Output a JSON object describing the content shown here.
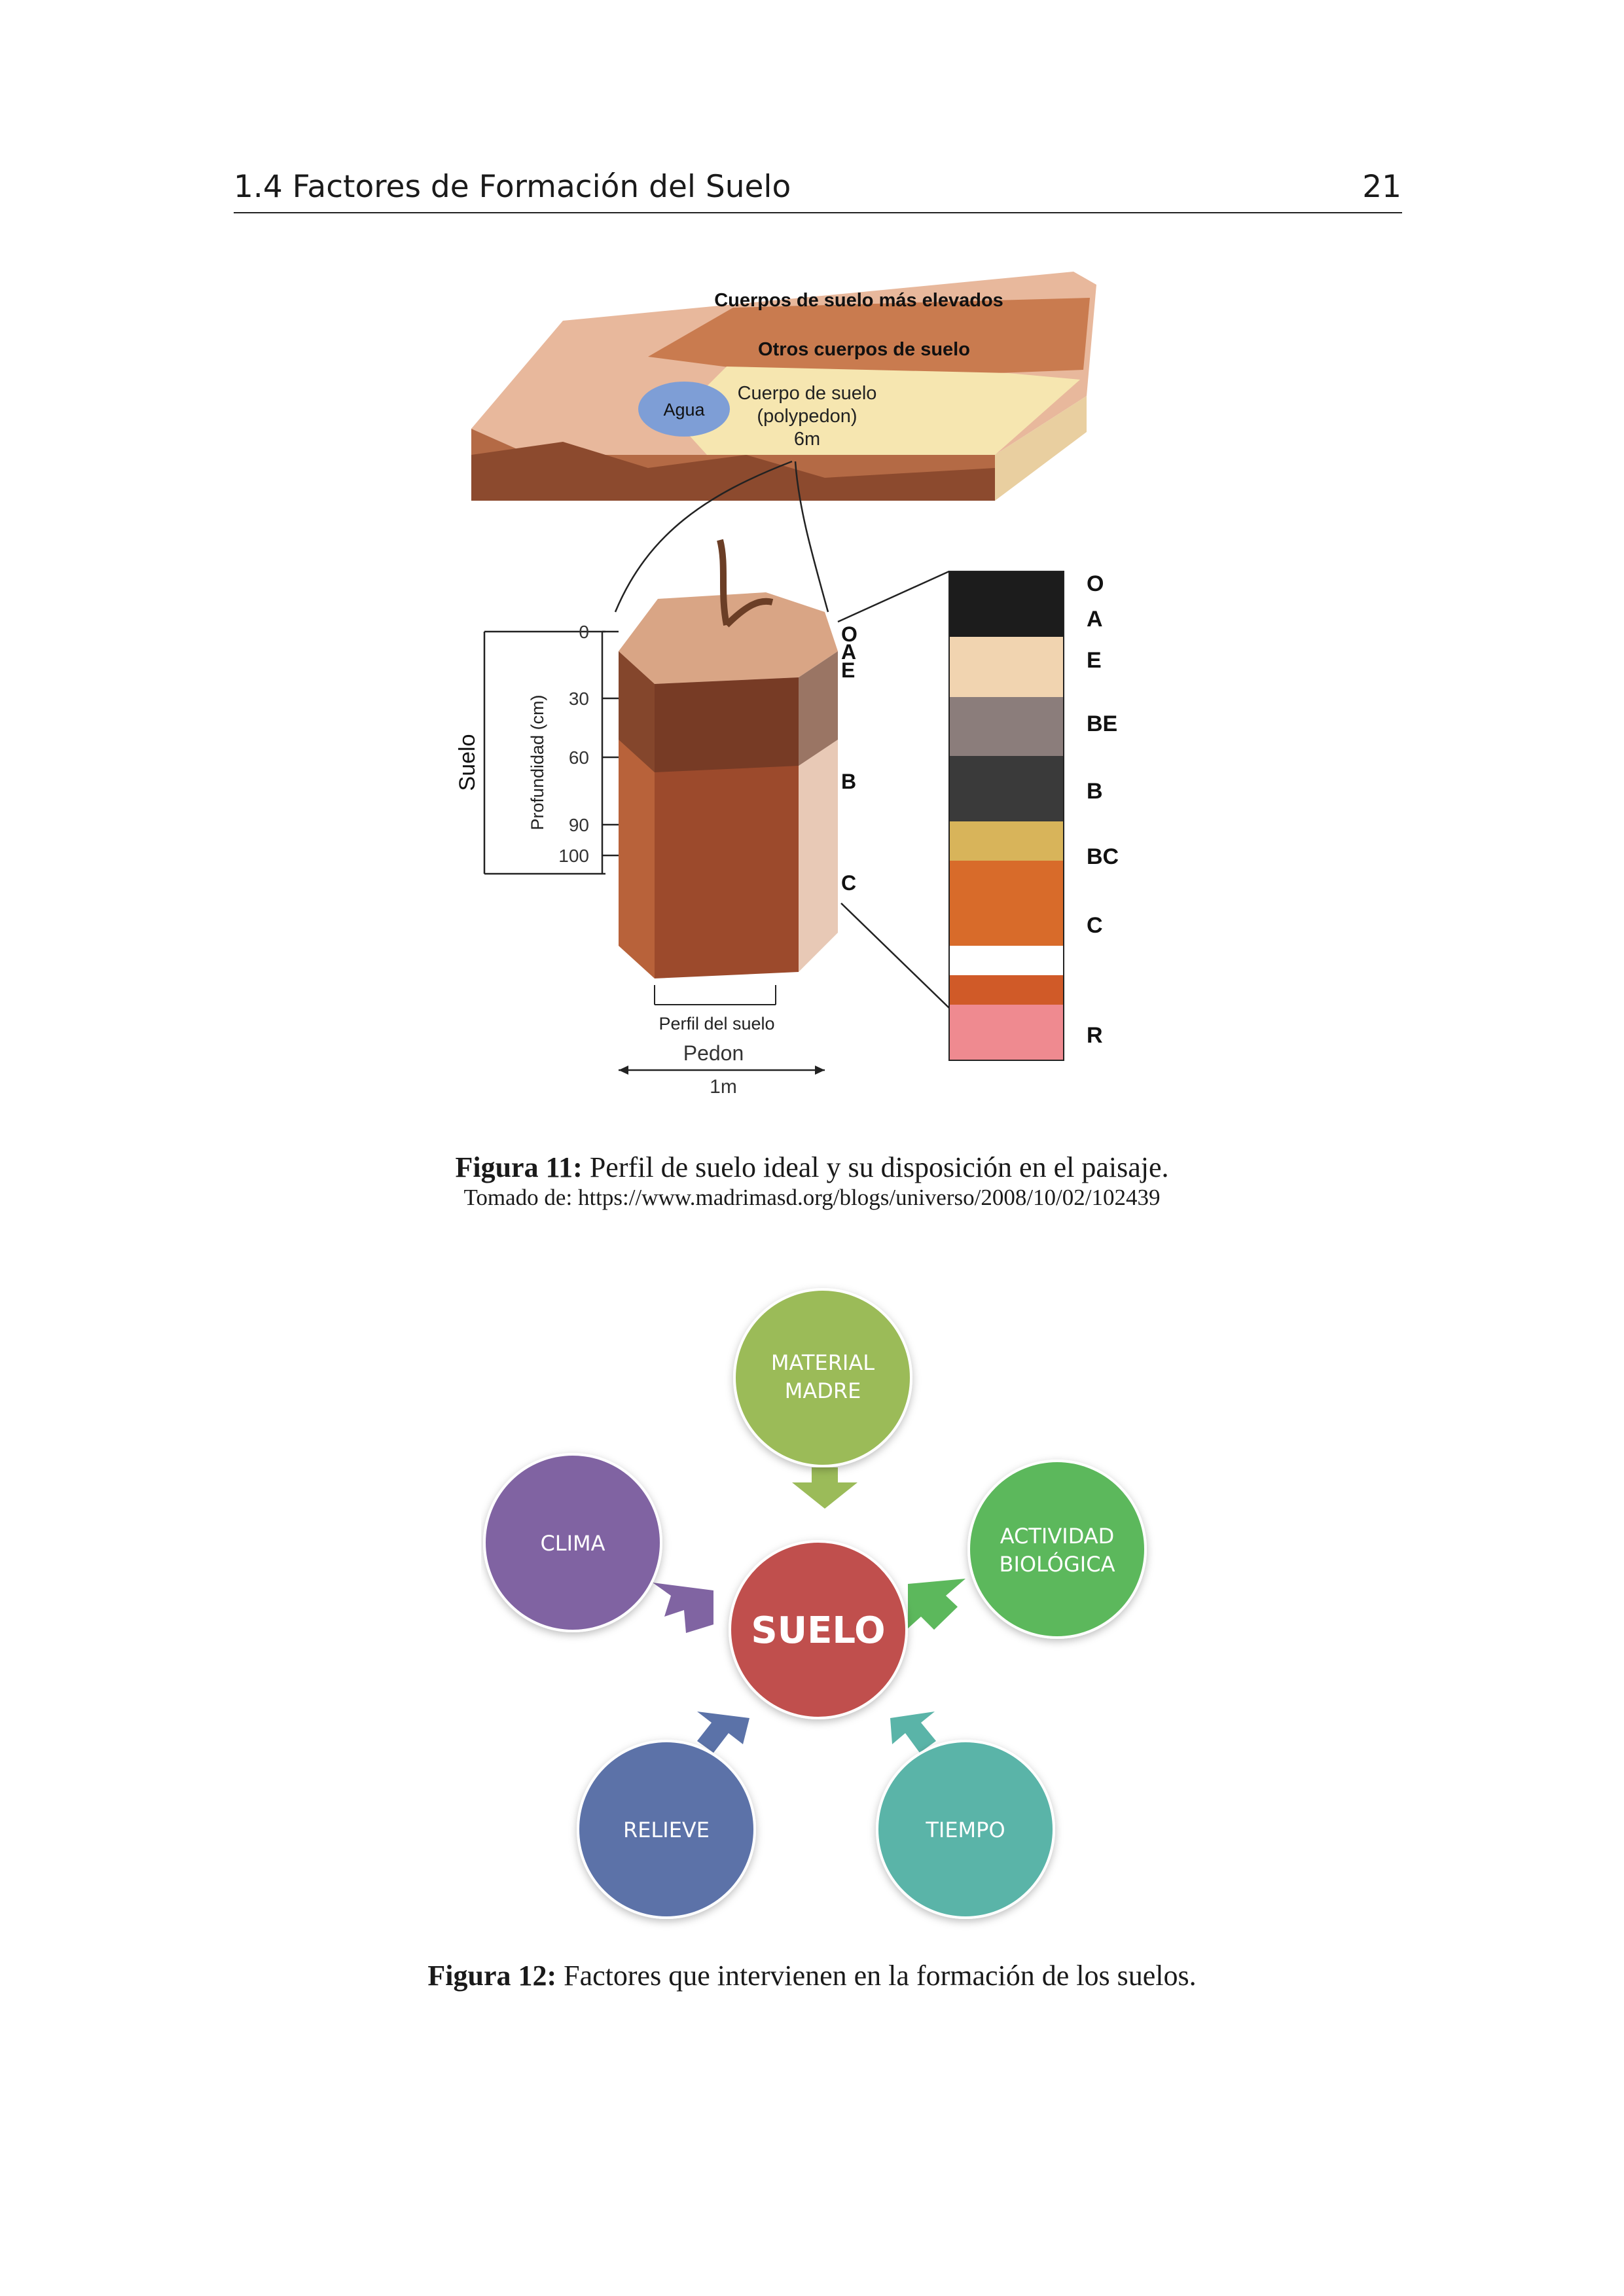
{
  "header": {
    "section_title": "1.4 Factores de Formación del Suelo",
    "page_number": "21"
  },
  "figure11": {
    "block_labels": {
      "higher_bodies": "Cuerpos de suelo más elevados",
      "other_bodies": "Otros cuerpos de suelo",
      "water": "Agua",
      "polypedon_line1": "Cuerpo de suelo",
      "polypedon_line2": "(polypedon)",
      "polypedon_width": "6m"
    },
    "depth_axis": {
      "side_label": "Suelo",
      "axis_label": "Profundidad (cm)",
      "ticks": [
        "0",
        "30",
        "60",
        "90",
        "100"
      ]
    },
    "pedon_horizons": [
      "O",
      "A",
      "E",
      "B",
      "C"
    ],
    "pedon_labels": {
      "profile": "Perfil del suelo",
      "pedon": "Pedon",
      "width": "1m"
    },
    "profile_horizons": [
      "O",
      "A",
      "E",
      "BE",
      "B",
      "BC",
      "C",
      "R"
    ],
    "caption_label": "Figura 11:",
    "caption_text": " Perfil de suelo ideal y su disposición en el paisaje.",
    "source": "Tomado de: https://www.madrimasd.org/blogs/universo/2008/10/02/102439"
  },
  "figure12": {
    "center": "SUELO",
    "factors": {
      "material_line1": "MATERIAL",
      "material_line2": "MADRE",
      "actividad_line1": "ACTIVIDAD",
      "actividad_line2": "BIOLÓGICA",
      "clima": "CLIMA",
      "relieve": "RELIEVE",
      "tiempo": "TIEMPO"
    },
    "colors": {
      "suelo": "#c0504d",
      "material": "#9bbb59",
      "actividad": "#5cb85c",
      "clima": "#8064a2",
      "relieve": "#5b72a8",
      "tiempo": "#5ab4a8"
    },
    "caption_label": "Figura 12:",
    "caption_text": " Factores que intervienen en la formación de los suelos."
  }
}
